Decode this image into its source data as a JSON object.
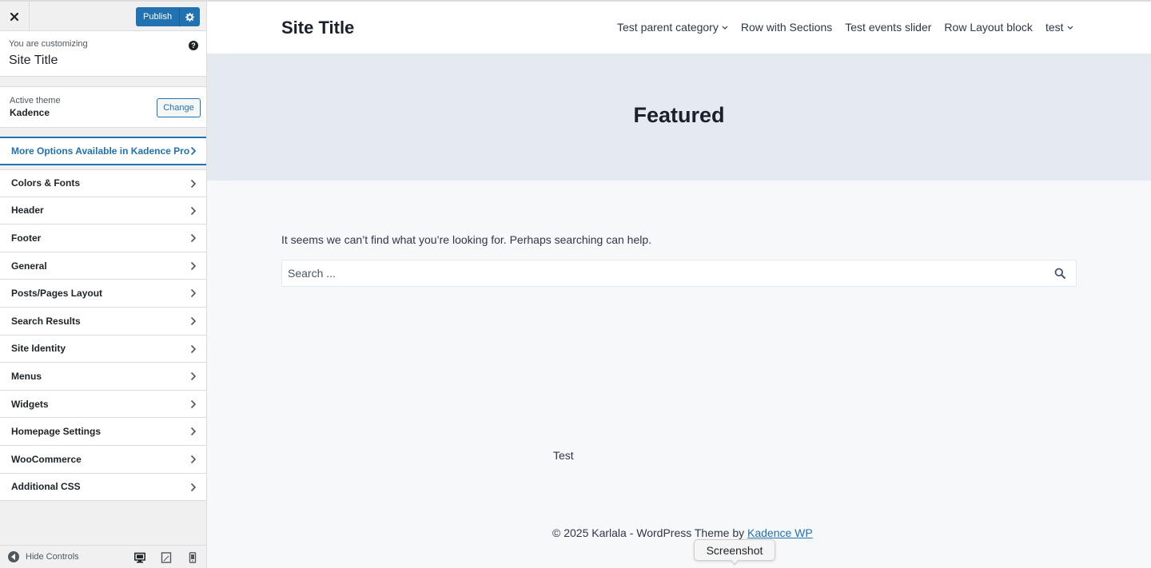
{
  "customizer": {
    "publish_label": "Publish",
    "customizing_label": "You are customizing",
    "customizing_title": "Site Title",
    "help_glyph": "?",
    "active_theme_label": "Active theme",
    "active_theme_name": "Kadence",
    "change_label": "Change",
    "pro_options_label": "More Options Available in Kadence Pro",
    "panels": [
      {
        "label": "Colors & Fonts"
      },
      {
        "label": "Header"
      },
      {
        "label": "Footer"
      },
      {
        "label": "General"
      },
      {
        "label": "Posts/Pages Layout"
      },
      {
        "label": "Search Results"
      },
      {
        "label": "Site Identity"
      },
      {
        "label": "Menus"
      },
      {
        "label": "Widgets"
      },
      {
        "label": "Homepage Settings"
      },
      {
        "label": "WooCommerce"
      },
      {
        "label": "Additional CSS"
      }
    ],
    "hide_controls_label": "Hide Controls",
    "accent_color": "#2271b1"
  },
  "preview": {
    "site_title": "Site Title",
    "nav": [
      {
        "label": "Test parent category",
        "has_dropdown": true
      },
      {
        "label": "Row with Sections",
        "has_dropdown": false
      },
      {
        "label": "Test events slider",
        "has_dropdown": false
      },
      {
        "label": "Row Layout block",
        "has_dropdown": false
      },
      {
        "label": "test",
        "has_dropdown": true
      }
    ],
    "hero_title": "Featured",
    "not_found_text": "It seems we can’t find what you’re looking for. Perhaps searching can help.",
    "search_placeholder": "Search ...",
    "footer_widget_text": "Test",
    "copyright_text": "© 2025 Karlala - WordPress Theme by ",
    "copyright_link": "Kadence WP"
  },
  "tooltip": {
    "text": "Screenshot"
  }
}
